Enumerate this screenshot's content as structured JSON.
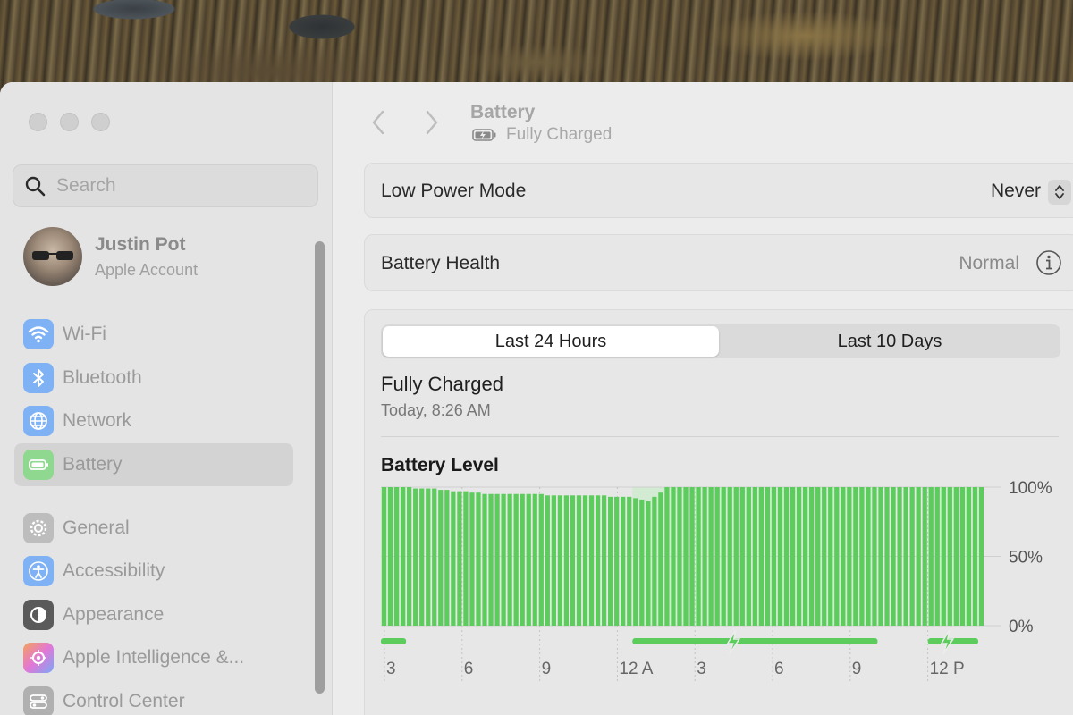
{
  "window": {
    "traffic_lights": [
      "close",
      "minimize",
      "zoom"
    ]
  },
  "sidebar": {
    "search": {
      "placeholder": "Search",
      "icon": "search-icon"
    },
    "account": {
      "name": "Justin Pot",
      "subtitle": "Apple Account"
    },
    "items": [
      {
        "label": "Wi-Fi",
        "icon": "wifi-icon",
        "color": "#3b8cf6",
        "selected": false
      },
      {
        "label": "Bluetooth",
        "icon": "bluetooth-icon",
        "color": "#3b8cf6",
        "selected": false
      },
      {
        "label": "Network",
        "icon": "globe-icon",
        "color": "#3b8cf6",
        "selected": false
      },
      {
        "label": "Battery",
        "icon": "battery-icon",
        "color": "#34c759",
        "selected": true
      },
      {
        "label": "General",
        "icon": "gear-icon",
        "color": "#8e8e93",
        "selected": false
      },
      {
        "label": "Accessibility",
        "icon": "accessibility-icon",
        "color": "#3b8cf6",
        "selected": false
      },
      {
        "label": "Appearance",
        "icon": "appearance-icon",
        "color": "#1c1c1e",
        "selected": false
      },
      {
        "label": "Apple Intelligence &...",
        "icon": "apple-intelligence-icon",
        "color": "#d26cf0",
        "selected": false
      },
      {
        "label": "Control Center",
        "icon": "control-center-icon",
        "color": "#8e8e93",
        "selected": false
      }
    ]
  },
  "header": {
    "title": "Battery",
    "subtitle": "Fully Charged"
  },
  "settings": {
    "low_power_mode": {
      "label": "Low Power Mode",
      "value": "Never"
    },
    "battery_health": {
      "label": "Battery Health",
      "value": "Normal"
    }
  },
  "usage": {
    "tabs": [
      {
        "label": "Last 24 Hours",
        "active": true
      },
      {
        "label": "Last 10 Days",
        "active": false
      }
    ],
    "status": "Fully Charged",
    "status_time": "Today, 8:26 AM"
  },
  "chart_data": {
    "type": "bar",
    "title": "Battery Level",
    "x_tick_labels": [
      "3",
      "6",
      "9",
      "12 A",
      "3",
      "6",
      "9",
      "12 P"
    ],
    "y_tick_labels": [
      "100%",
      "50%",
      "0%"
    ],
    "ylim": [
      0,
      100
    ],
    "grid": true,
    "bar_color": "#5ccc5c",
    "charging_color": "#5ccc5c",
    "values": [
      100,
      100,
      100,
      100,
      100,
      99,
      99,
      99,
      99,
      98,
      98,
      97,
      97,
      97,
      96,
      96,
      95,
      95,
      95,
      95,
      95,
      95,
      95,
      95,
      95,
      95,
      94,
      94,
      94,
      94,
      94,
      94,
      94,
      94,
      94,
      94,
      93,
      93,
      93,
      93,
      92,
      91,
      90,
      93,
      96,
      100,
      100,
      100,
      100,
      100,
      100,
      100,
      100,
      100,
      100,
      100,
      100,
      100,
      100,
      100,
      100,
      100,
      100,
      100,
      100,
      100,
      100,
      100,
      100,
      100,
      100,
      100,
      100,
      100,
      100,
      100,
      100,
      100,
      100,
      100,
      100,
      100,
      100,
      100,
      100,
      100,
      100,
      100,
      100,
      100,
      100,
      100,
      100,
      100,
      100,
      100
    ],
    "charging_ranges": [
      [
        0,
        4
      ],
      [
        40,
        79
      ],
      [
        87,
        95
      ]
    ],
    "charging_icon_positions": [
      56,
      90
    ]
  }
}
